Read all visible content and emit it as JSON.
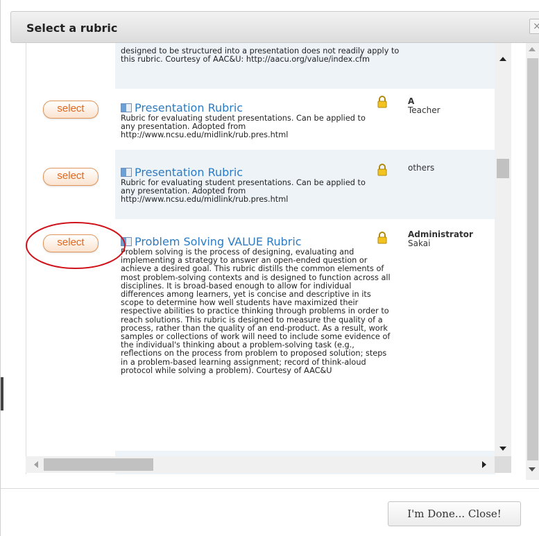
{
  "dialog": {
    "title": "Select a rubric",
    "close_icon": "×",
    "done_button": "I'm Done... Close!"
  },
  "rows": [
    {
      "description": "designed to be structured into a presentation does not readily apply to this rubric. Courtesy of AAC&U: http://aacu.org/value/index.cfm"
    },
    {
      "select_label": "select",
      "title": "Presentation Rubric",
      "description": "Rubric for evaluating student presentations. Can be applied to any presentation. Adopted from http://www.ncsu.edu/midlink/rub.pres.html",
      "owner_name": "A",
      "owner_role": "Teacher"
    },
    {
      "select_label": "select",
      "title": "Presentation Rubric",
      "description": "Rubric for evaluating student presentations. Can be applied to any presentation. Adopted from http://www.ncsu.edu/midlink/rub.pres.html",
      "owner_name": "others",
      "owner_role": ""
    },
    {
      "select_label": "select",
      "title": "Problem Solving VALUE Rubric",
      "description": "Problem solving is the process of designing, evaluating and implementing a strategy to answer an open-ended question or achieve a desired goal. This rubric distills the common elements of most problem-solving contexts and is designed to function across all disciplines. It is broad-based enough to allow for individual differences among learners, yet is concise and descriptive in its scope to determine how well students have maximized their respective abilities to practice thinking through problems in order to reach solutions. This rubric is designed to measure the quality of a process, rather than the quality of an end-product. As a result, work samples or collections of work will need to include some evidence of the individual's thinking about a problem-solving task (e.g., reflections on the process from problem to proposed solution; steps in a problem-based learning assignment; record of think-aloud protocol while solving a problem). Courtesy of AAC&U",
      "owner_name": "Administrator",
      "owner_role": "Sakai"
    }
  ],
  "colors": {
    "select_text": "#e4661b",
    "title_link": "#2b7bc4",
    "highlight_oval": "#d0121b"
  },
  "icons": {
    "rubric": "rubric-icon",
    "lock": "lock-icon"
  }
}
